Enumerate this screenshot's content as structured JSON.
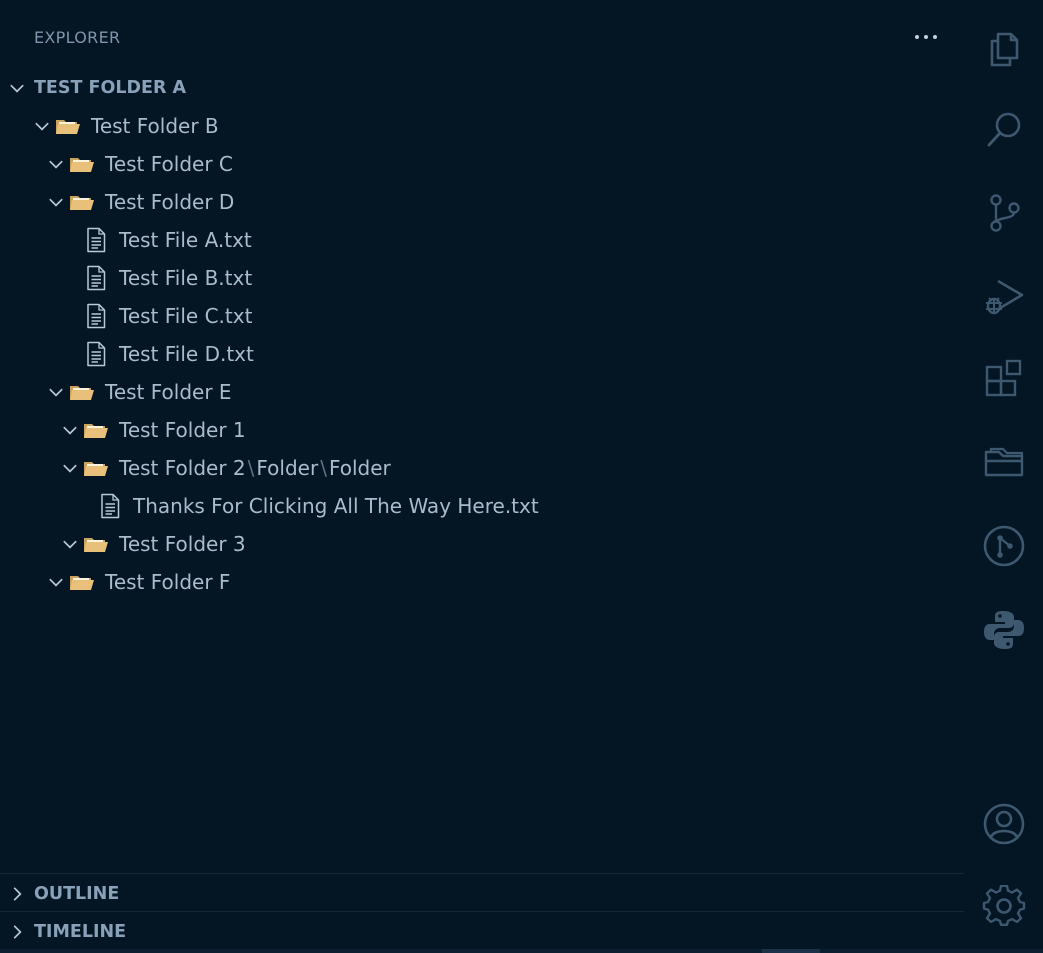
{
  "explorer": {
    "title": "EXPLORER",
    "more_icon": "ellipsis-icon"
  },
  "root": {
    "label": "TEST FOLDER A",
    "expanded": true
  },
  "tree": [
    {
      "label": "Test Folder B",
      "type": "folder",
      "depth": 1
    },
    {
      "label": "Test Folder C",
      "type": "folder",
      "depth": 2
    },
    {
      "label": "Test Folder D",
      "type": "folder",
      "depth": 2
    },
    {
      "label": "Test File A.txt",
      "type": "file",
      "depth": 3
    },
    {
      "label": "Test File B.txt",
      "type": "file",
      "depth": 3
    },
    {
      "label": "Test File C.txt",
      "type": "file",
      "depth": 3
    },
    {
      "label": "Test File D.txt",
      "type": "file",
      "depth": 3
    },
    {
      "label": "Test Folder E",
      "type": "folder",
      "depth": 2
    },
    {
      "label": "Test Folder 1",
      "type": "folder",
      "depth": 3
    },
    {
      "label": "Test Folder 2",
      "type": "folder",
      "depth": 3,
      "compact": [
        "Folder",
        "Folder"
      ],
      "separator": "\\"
    },
    {
      "label": "Thanks For Clicking All The Way Here.txt",
      "type": "file",
      "depth": 4
    },
    {
      "label": "Test Folder 3",
      "type": "folder",
      "depth": 3
    },
    {
      "label": "Test Folder F",
      "type": "folder",
      "depth": 2
    }
  ],
  "sections": {
    "outline": "OUTLINE",
    "timeline": "TIMELINE"
  },
  "activity_bar": [
    "files-icon",
    "search-icon",
    "source-control-icon",
    "run-debug-icon",
    "extensions-icon",
    "remote-explorer-icon",
    "git-graph-icon",
    "python-icon"
  ],
  "activity_bottom": [
    "account-icon",
    "settings-gear-icon"
  ],
  "colors": {
    "background": "#041524",
    "folder": "#e8c07a",
    "text": "#a9bccd",
    "icon": "#3e5870"
  }
}
